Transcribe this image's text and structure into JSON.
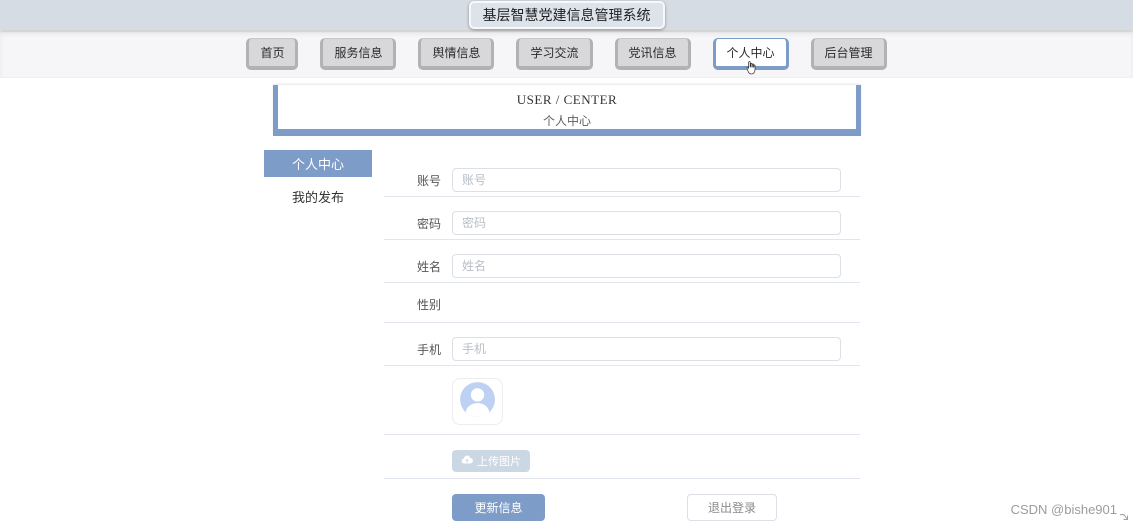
{
  "header": {
    "title": "基层智慧党建信息管理系统"
  },
  "nav": {
    "items": [
      {
        "label": "首页",
        "active": false
      },
      {
        "label": "服务信息",
        "active": false
      },
      {
        "label": "舆情信息",
        "active": false
      },
      {
        "label": "学习交流",
        "active": false
      },
      {
        "label": "党讯信息",
        "active": false
      },
      {
        "label": "个人中心",
        "active": true
      },
      {
        "label": "后台管理",
        "active": false
      }
    ]
  },
  "banner": {
    "title_en": "USER / CENTER",
    "title_zh": "个人中心"
  },
  "sidebar": {
    "items": [
      {
        "label": "个人中心",
        "active": true
      },
      {
        "label": "我的发布",
        "active": false
      }
    ]
  },
  "form": {
    "fields": [
      {
        "label": "账号",
        "placeholder": "账号",
        "value": ""
      },
      {
        "label": "密码",
        "placeholder": "密码",
        "value": ""
      },
      {
        "label": "姓名",
        "placeholder": "姓名",
        "value": ""
      },
      {
        "label": "性别"
      },
      {
        "label": "手机",
        "placeholder": "手机",
        "value": ""
      }
    ],
    "avatar_icon": "person-avatar-placeholder",
    "upload_icon": "cloud-upload-icon",
    "upload_label": "上传图片",
    "update_label": "更新信息",
    "logout_label": "退出登录"
  },
  "watermark": "CSDN @bishe901",
  "colors": {
    "accent": "#7d9cc8",
    "top_band": "#d6dce4",
    "nav_band": "#f6f5f7",
    "nav_button_face": "#d8d8da",
    "nav_button_edge": "#b2b2b6",
    "upload_button": "#ccd7e4",
    "avatar_blue": "#bdd1f2",
    "divider": "#e0e5ee"
  }
}
